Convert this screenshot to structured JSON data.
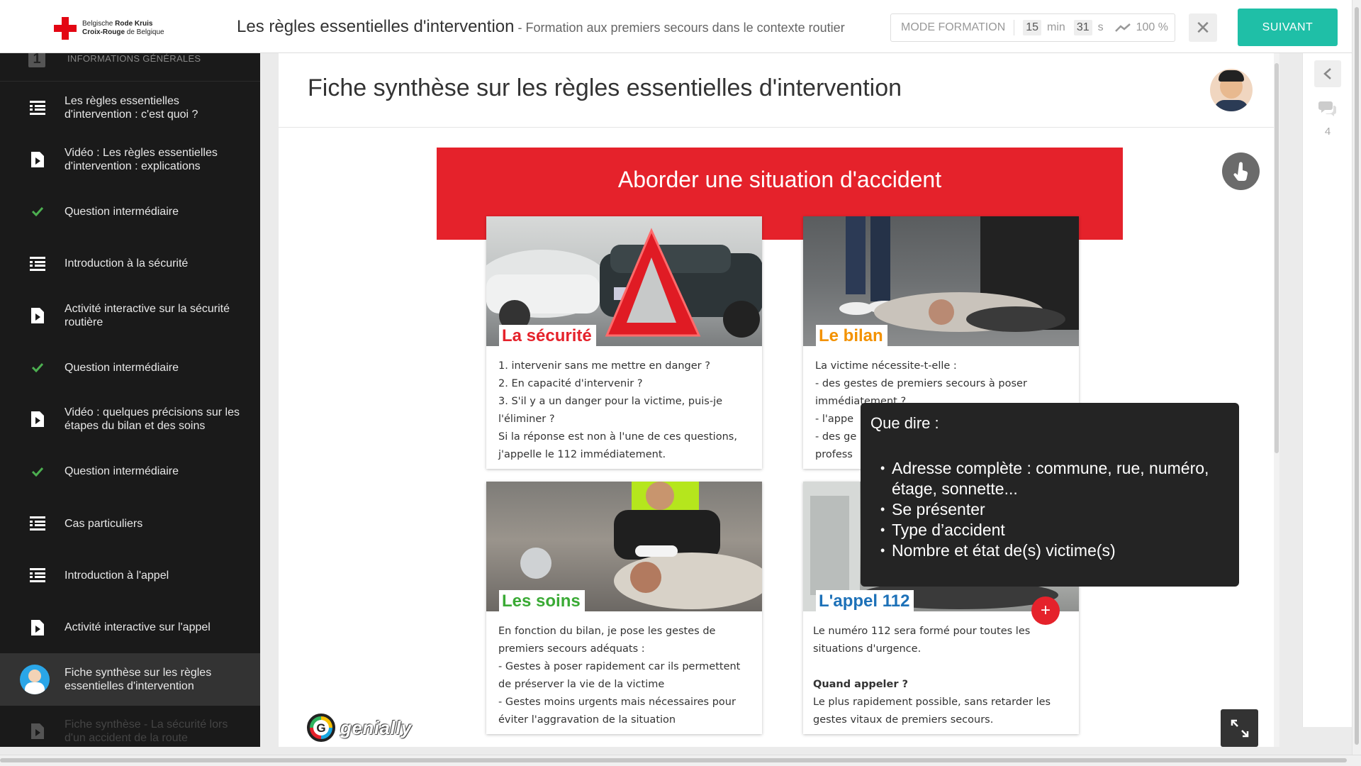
{
  "header": {
    "logo_line1_a": "Belgische ",
    "logo_line1_b": "Rode Kruis",
    "logo_line2_a": "Croix-Rouge",
    "logo_line2_b": " de Belgique",
    "title": "Les règles essentielles d'intervention",
    "subtitle": " - Formation aux premiers secours dans le contexte routier",
    "mode_label": "MODE FORMATION",
    "minutes": "15",
    "minutes_unit": "min",
    "seconds": "31",
    "seconds_unit": "s",
    "progress": "100 %",
    "close_symbol": "✕",
    "next_label": "SUIVANT"
  },
  "sidebar": {
    "section_number": "1",
    "section_label": "INFORMATIONS GÉNÉRALES",
    "items": [
      {
        "label": "Les règles essentielles d'intervention : c'est quoi ?",
        "icon": "text-lines-icon",
        "state": "normal"
      },
      {
        "label": "Vidéo : Les règles essentielles d'intervention : explications",
        "icon": "document-play-icon",
        "state": "normal"
      },
      {
        "label": "Question intermédiaire",
        "icon": "check-icon",
        "state": "normal"
      },
      {
        "label": "Introduction à la sécurité",
        "icon": "text-lines-icon",
        "state": "normal"
      },
      {
        "label": "Activité interactive sur la sécurité routière",
        "icon": "document-play-icon",
        "state": "normal"
      },
      {
        "label": "Question intermédiaire",
        "icon": "check-icon",
        "state": "normal"
      },
      {
        "label": "Vidéo : quelques précisions sur les étapes du bilan et des soins",
        "icon": "document-play-icon",
        "state": "normal"
      },
      {
        "label": "Question intermédiaire",
        "icon": "check-icon",
        "state": "normal"
      },
      {
        "label": "Cas particuliers",
        "icon": "text-lines-icon",
        "state": "normal"
      },
      {
        "label": "Introduction à l'appel",
        "icon": "text-lines-icon",
        "state": "normal"
      },
      {
        "label": "Activité interactive sur l'appel",
        "icon": "document-play-icon",
        "state": "normal"
      },
      {
        "label": "Fiche synthèse sur les règles essentielles d'intervention",
        "icon": "avatar-icon",
        "state": "active"
      },
      {
        "label": "Fiche synthèse - La sécurité lors d'un accident de la route",
        "icon": "document-play-icon",
        "state": "dim"
      }
    ]
  },
  "content": {
    "title": "Fiche synthèse sur les règles essentielles d'intervention",
    "banner_title": "Aborder une situation d'accident",
    "cards": [
      {
        "label": "La sécurité",
        "label_color": "#e5222b",
        "lines": [
          "1.  intervenir sans me mettre en danger ?",
          "2.  En capacité d'intervenir ?",
          "3. S'il y a un danger pour la victime, puis-je l'éliminer ?",
          "Si la réponse est non à l'une de ces questions, j'appelle le 112 immédiatement."
        ]
      },
      {
        "label": "Le bilan",
        "label_color": "#f39200",
        "lines": [
          "La victime nécessite-t-elle :",
          "- des gestes de premiers secours à poser immédiatement ?",
          "- l'appe",
          "- des ge",
          "profess"
        ]
      },
      {
        "label": "Les soins",
        "label_color": "#3aaa35",
        "lines": [
          "En fonction du bilan, je pose les gestes de premiers secours adéquats :",
          "- Gestes à poser rapidement car ils permettent de préserver la vie de la victime",
          "- Gestes moins urgents mais nécessaires pour éviter l'aggravation de la situation"
        ]
      },
      {
        "label": "L'appel 112",
        "label_color": "#1d71b8",
        "lines": [
          "Le numéro 112 sera formé pour toutes les situations d'urgence.",
          "",
          "Quand appeler ?",
          "Le plus rapidement possible, sans retarder les gestes vitaux de premiers secours."
        ]
      }
    ],
    "tooltip": {
      "title": "Que dire :",
      "items": [
        "Adresse complète : commune, rue, numéro, étage, sonnette...",
        "Se présenter",
        "Type d’accident",
        "Nombre et état de(s) victime(s)"
      ]
    },
    "plus_symbol": "+",
    "brand": "genially",
    "brand_letter": "G"
  },
  "right_panel": {
    "comments_count": "4"
  },
  "colors": {
    "accent_teal": "#1fbfa7",
    "banner_red": "#e5222b",
    "sidebar_bg": "#1a1a1a",
    "check_green": "#4caf50"
  }
}
